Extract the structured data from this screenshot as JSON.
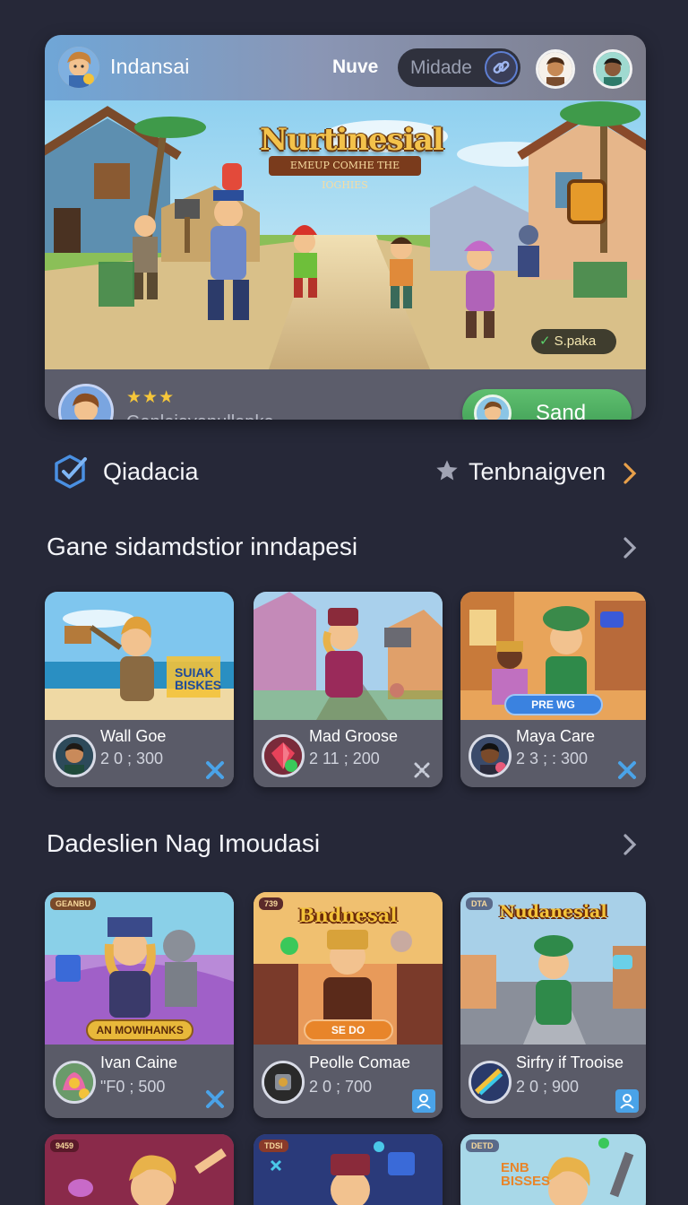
{
  "header": {
    "app_name": "Indansai",
    "nav_link": "Nuve",
    "mode_label": "Midade"
  },
  "banner": {
    "title": "Nurtinesial",
    "subtitle": "EMEUP COMHE THE IOGHIES",
    "badge": "S.paka"
  },
  "player": {
    "stars": "★★★",
    "name": "Ganleiayanullapke.",
    "send_label": "Sand"
  },
  "quick": {
    "left_label": "Qiadacia",
    "right_label": "Tenbnaigven"
  },
  "section1": {
    "title": "Gane sidamdstior inndapesi",
    "cards": [
      {
        "name": "Wall Goe",
        "score": "2 0 ; 300",
        "art_text": "SUIAK BISKES"
      },
      {
        "name": "Mad Groose",
        "score": "2 11 ; 200",
        "art_text": ""
      },
      {
        "name": "Maya Care",
        "score": "2 3 ; : 300",
        "art_text": "PRE WG"
      }
    ]
  },
  "section2": {
    "title": "Dadeslien Nag Imoudasi",
    "cards": [
      {
        "name": "Ivan Caine",
        "score": "\"F0 ; 500",
        "art_text": "AN MOWIHANKS",
        "corner": "GEANBU"
      },
      {
        "name": "Peolle Comae",
        "score": "2 0 ; 700",
        "art_text": "SE DO",
        "corner": "739",
        "title_art": "Bndnesal"
      },
      {
        "name": "Sirfry if Trooise",
        "score": "2 0 ; 900",
        "art_text": "",
        "corner": "DTA",
        "title_art": "Nudanesial"
      }
    ]
  },
  "section3": {
    "cards": [
      {
        "corner": "9459"
      },
      {
        "corner": "TDSI"
      },
      {
        "corner": "DETD",
        "art_text": "ENB BISSES"
      }
    ]
  }
}
